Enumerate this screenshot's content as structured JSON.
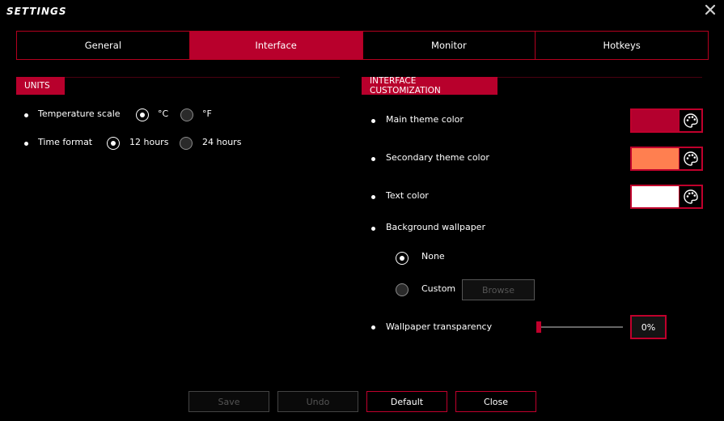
{
  "window": {
    "title": "SETTINGS"
  },
  "tabs": [
    {
      "label": "General"
    },
    {
      "label": "Interface"
    },
    {
      "label": "Monitor"
    },
    {
      "label": "Hotkeys"
    }
  ],
  "active_tab": "Interface",
  "units": {
    "header": "UNITS",
    "temperature_label": "Temperature scale",
    "temp_options": [
      "°C",
      "°F"
    ],
    "temp_selected": "°C",
    "time_label": "Time format",
    "time_options": [
      "12 hours",
      "24 hours"
    ],
    "time_selected": "12 hours"
  },
  "customization": {
    "header": "INTERFACE CUSTOMIZATION",
    "main_theme_label": "Main theme color",
    "main_theme_color": "#b4002e",
    "secondary_theme_label": "Secondary theme color",
    "secondary_theme_color": "#ff7f50",
    "text_color_label": "Text color",
    "text_color": "#ffffff",
    "wallpaper_label": "Background wallpaper",
    "wallpaper_none": "None",
    "wallpaper_custom": "Custom",
    "wallpaper_selected": "None",
    "browse_label": "Browse",
    "transparency_label": "Wallpaper transparency",
    "transparency_value": "0%"
  },
  "footer": {
    "save": "Save",
    "undo": "Undo",
    "default": "Default",
    "close": "Close"
  },
  "icons": [
    "close-icon",
    "palette-icon"
  ],
  "colors": {
    "accent": "#b8002c",
    "background": "#000000"
  }
}
